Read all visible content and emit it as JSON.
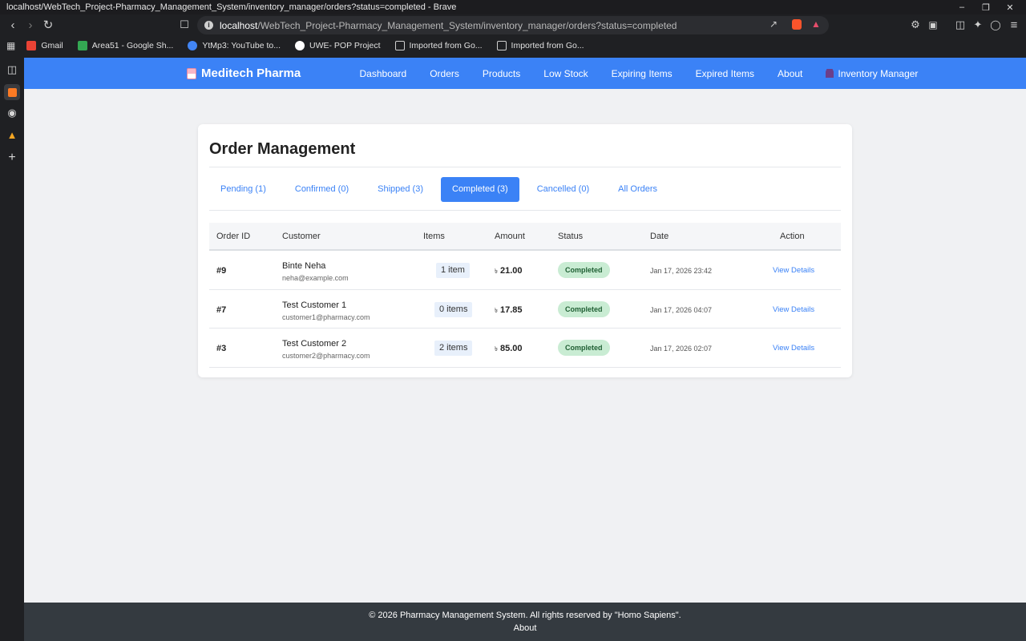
{
  "browser": {
    "window_title": "localhost/WebTech_Project-Pharmacy_Management_System/inventory_manager/orders?status=completed - Brave",
    "url_host": "localhost",
    "url_path": "/WebTech_Project-Pharmacy_Management_System/inventory_manager/orders?status=completed",
    "bookmarks": [
      {
        "label": "Gmail",
        "icon": "gmail-icon",
        "color": "#ea4335"
      },
      {
        "label": "Area51 - Google Sh...",
        "icon": "sheets-icon",
        "color": "#34a853"
      },
      {
        "label": "YtMp3: YouTube to...",
        "icon": "ytmp3-icon",
        "color": "#4285f4"
      },
      {
        "label": "UWE- POP Project",
        "icon": "github-icon",
        "color": "#ffffff"
      },
      {
        "label": "Imported from Go...",
        "icon": "folder-icon",
        "color": "#cfcfcf"
      },
      {
        "label": "Imported from Go...",
        "icon": "folder-icon",
        "color": "#cfcfcf"
      }
    ]
  },
  "navbar": {
    "brand": "Meditech Pharma",
    "brand_icon": "pill-icon",
    "links": [
      "Dashboard",
      "Orders",
      "Products",
      "Low Stock",
      "Expiring Items",
      "Expired Items",
      "About"
    ],
    "user": "Inventory Manager",
    "user_icon": "user-icon",
    "color": "#3b82f6"
  },
  "page": {
    "title": "Order Management",
    "tabs": [
      {
        "label": "Pending (1)",
        "active": false
      },
      {
        "label": "Confirmed (0)",
        "active": false
      },
      {
        "label": "Shipped (3)",
        "active": false
      },
      {
        "label": "Completed (3)",
        "active": true
      },
      {
        "label": "Cancelled (0)",
        "active": false
      },
      {
        "label": "All Orders",
        "active": false
      }
    ],
    "table": {
      "headers": {
        "order_id": "Order ID",
        "customer": "Customer",
        "items": "Items",
        "amount": "Amount",
        "status": "Status",
        "date": "Date",
        "action": "Action"
      },
      "rows": [
        {
          "order_id": "#9",
          "customer": "Binte Neha",
          "email": "neha@example.com",
          "items": "1 item",
          "currency": "৳",
          "amount": "21.00",
          "status": "Completed",
          "date": "Jan 17, 2026 23:42",
          "action": "View Details"
        },
        {
          "order_id": "#7",
          "customer": "Test Customer 1",
          "email": "customer1@pharmacy.com",
          "items": "0 items",
          "currency": "৳",
          "amount": "17.85",
          "status": "Completed",
          "date": "Jan 17, 2026 04:07",
          "action": "View Details"
        },
        {
          "order_id": "#3",
          "customer": "Test Customer 2",
          "email": "customer2@pharmacy.com",
          "items": "2 items",
          "currency": "৳",
          "amount": "85.00",
          "status": "Completed",
          "date": "Jan 17, 2026 02:07",
          "action": "View Details"
        }
      ]
    }
  },
  "footer": {
    "copyright": "© 2026 Pharmacy Management System. All rights reserved by \"Homo Sapiens\".",
    "link": "About"
  }
}
